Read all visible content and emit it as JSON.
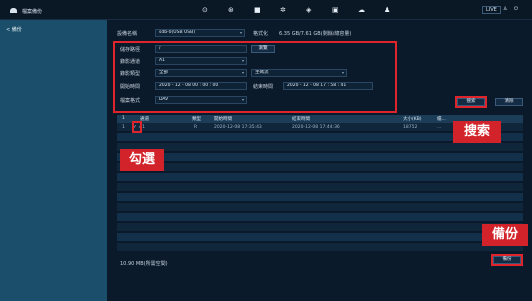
{
  "topbar": {
    "title": "檔案備份",
    "icons": [
      "live-view-icon",
      "playback-icon",
      "camera-icon",
      "settings-gear-icon",
      "layers-icon",
      "storage-icon",
      "cloud-icon",
      "user-icon"
    ],
    "right_button": "LIVE",
    "right_icons": [
      "person-icon",
      "power-icon"
    ]
  },
  "sidebar": {
    "items": [
      {
        "label": "< 備份"
      }
    ]
  },
  "form": {
    "storage_label": "設備名稱",
    "storage_value": "sdb-0(USB USB)",
    "format_label": "格式化",
    "capacity": "6.35 GB/7.61 GB(剩餘/總容量)",
    "directory_label": "儲存路徑",
    "directory_value": "/",
    "browse_label": "瀏覽",
    "channel_label": "錄影通道",
    "channel_value": "A1",
    "type_label": "錄影類型",
    "type_value": "全部",
    "stream_value": "主碼流",
    "start_label": "開始時間",
    "start_value": "2020 - 12 - 08    00 : 00 : 00",
    "end_label": "結束時間",
    "end_value": "2020 - 12 - 08    17 : 58 : 41",
    "format_type_label": "檔案格式",
    "format_type_value": "DAV",
    "search_button": "搜索",
    "clear_button": "清除"
  },
  "table": {
    "headers": [
      "1",
      "通道",
      "類型",
      "開始時間",
      "結束時間",
      "大小(KB)",
      "檔..."
    ],
    "rows": [
      {
        "index": "1",
        "check": "✓",
        "channel": "A1",
        "type": "R",
        "start": "2020-12-08 17:35:43",
        "end": "2020-12-08 17:44:36",
        "size": "18752",
        "file": "..."
      }
    ]
  },
  "footer": {
    "space": "10.90 MB(所需空間)",
    "backup_button": "備份"
  },
  "callouts": {
    "check": "勾選",
    "search": "搜索",
    "backup": "備份"
  },
  "colors": {
    "accent_red": "#e0242b",
    "sidebar": "#1a4e6a",
    "background": "#0b1a2a"
  }
}
